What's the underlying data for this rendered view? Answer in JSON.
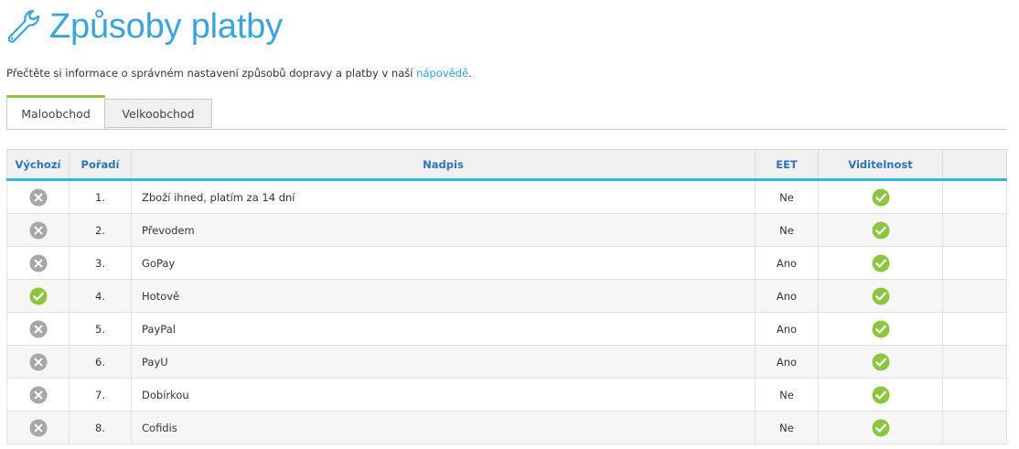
{
  "page": {
    "title": "Způsoby platby",
    "intro_text": "Přečtěte si informace o správném nastavení způsobů dopravy a platby v naší ",
    "intro_link": "nápovědě",
    "intro_end": "."
  },
  "icons": {
    "header": "wrench-icon",
    "yes": "check-circle-icon",
    "no": "x-circle-icon"
  },
  "colors": {
    "title": "#3aa5dc",
    "accent": "#33b5e5",
    "tab_active": "#8cc63f",
    "check": "#8cc63f",
    "x": "#a7a7a7"
  },
  "tabs": [
    {
      "label": "Maloobchod",
      "active": true
    },
    {
      "label": "Velkoobchod",
      "active": false
    }
  ],
  "table": {
    "headers": {
      "default": "Výchozí",
      "order": "Pořadí",
      "label": "Nadpis",
      "eet": "EET",
      "visibility": "Viditelnost"
    },
    "rows": [
      {
        "default": false,
        "order": "1.",
        "label": "Zboží ihned, platím za 14 dní",
        "eet": "Ne",
        "visible": true
      },
      {
        "default": false,
        "order": "2.",
        "label": "Převodem",
        "eet": "Ne",
        "visible": true
      },
      {
        "default": false,
        "order": "3.",
        "label": "GoPay",
        "eet": "Ano",
        "visible": true
      },
      {
        "default": true,
        "order": "4.",
        "label": "Hotově",
        "eet": "Ano",
        "visible": true
      },
      {
        "default": false,
        "order": "5.",
        "label": "PayPal",
        "eet": "Ano",
        "visible": true
      },
      {
        "default": false,
        "order": "6.",
        "label": "PayU",
        "eet": "Ano",
        "visible": true
      },
      {
        "default": false,
        "order": "7.",
        "label": "Dobírkou",
        "eet": "Ne",
        "visible": true
      },
      {
        "default": false,
        "order": "8.",
        "label": "Cofidis",
        "eet": "Ne",
        "visible": true
      }
    ]
  }
}
